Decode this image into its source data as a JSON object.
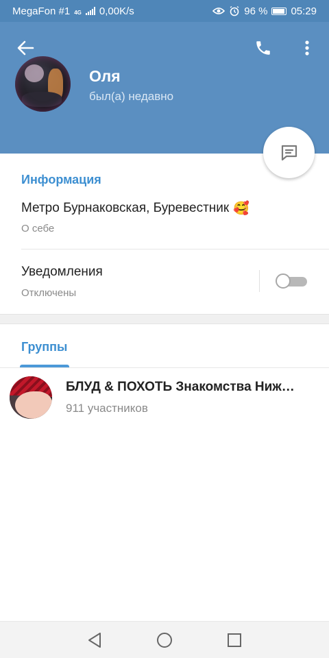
{
  "status_bar": {
    "carrier": "MegaFon #1",
    "network_type": "4G",
    "speed": "0,00K/s",
    "battery": "96 %",
    "time": "05:29"
  },
  "header": {
    "name": "Оля",
    "last_seen": "был(а) недавно"
  },
  "info": {
    "section_title": "Информация",
    "bio": "Метро Бурнаковская, Буревестник",
    "bio_emoji": "🥰",
    "bio_label": "О себе"
  },
  "notifications": {
    "title": "Уведомления",
    "status": "Отключены",
    "enabled": false
  },
  "groups_tab": {
    "label": "Группы"
  },
  "groups": [
    {
      "name": "БЛУД & ПОХОТЬ Знакомства Нижний Новгород",
      "members": "911 участников"
    }
  ],
  "colors": {
    "header": "#5b8fc1",
    "status_bar": "#4f86b8",
    "accent": "#3d8fd1"
  }
}
